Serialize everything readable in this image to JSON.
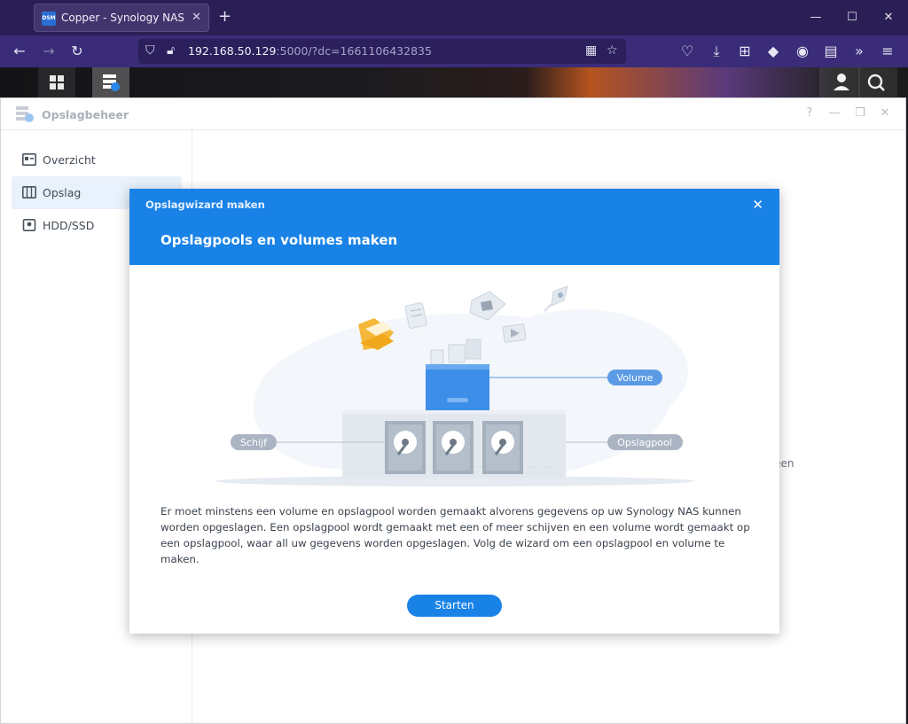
{
  "browser": {
    "tab_title": "Copper - Synology NAS",
    "tab_favicon_text": "DSM",
    "url_host": "192.168.50.129",
    "url_path": ":5000/?dc=1661106432835"
  },
  "app": {
    "title": "Opslagbeheer",
    "controls": {
      "help": "?",
      "minimize": "—",
      "restore": "❐",
      "close": "✕"
    }
  },
  "sidebar": {
    "items": [
      {
        "label": "Overzicht",
        "icon": "overview-icon"
      },
      {
        "label": "Opslag",
        "icon": "storage-icon",
        "active": true
      },
      {
        "label": "HDD/SSD",
        "icon": "hdd-icon"
      }
    ]
  },
  "background": {
    "text_fragment": "s een"
  },
  "modal": {
    "small_title": "Opslagwizard maken",
    "title": "Opslagpools en volumes maken",
    "labels": {
      "volume": "Volume",
      "disk": "Schijf",
      "pool": "Opslagpool"
    },
    "description": "Er moet minstens een volume en opslagpool worden gemaakt alvorens gegevens op uw Synology NAS kunnen worden opgeslagen. Een opslagpool wordt gemaakt met een of meer schijven en een volume wordt gemaakt op een opslagpool, waar all uw gegevens worden opgeslagen. Volg de wizard om een opslagpool en volume te maken.",
    "start_button": "Starten"
  },
  "colors": {
    "accent": "#1882e6",
    "label_pill": "#aab4c3",
    "volume_pill": "#5b9be6"
  }
}
